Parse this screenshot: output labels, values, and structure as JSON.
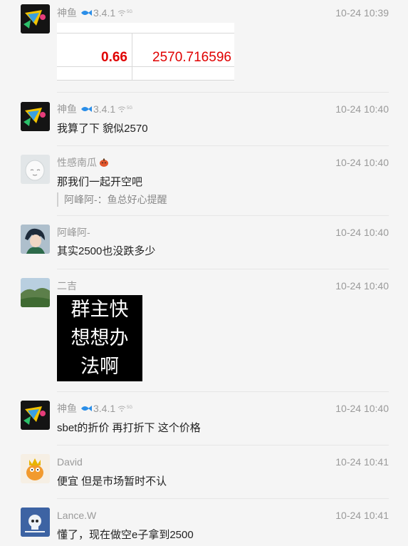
{
  "messages": [
    {
      "sender": "神鱼",
      "version": "3.4.1",
      "time": "10-24 10:39"
    },
    {
      "sender": "神鱼",
      "version": "3.4.1",
      "time": "10-24 10:40",
      "text": "我算了下 貌似2570"
    },
    {
      "sender": "性感南瓜",
      "time": "10-24 10:40",
      "text": "那我们一起开空吧",
      "quote": "阿峰阿-：鱼总好心提醒"
    },
    {
      "sender": "阿峰阿-",
      "time": "10-24 10:40",
      "text": "其实2500也没跌多少"
    },
    {
      "sender": "二吉",
      "time": "10-24 10:40"
    },
    {
      "sender": "神鱼",
      "version": "3.4.1",
      "time": "10-24 10:40",
      "text": "sbet的折价 再打折下 这个价格"
    },
    {
      "sender": "David",
      "time": "10-24 10:41",
      "text": "便宜 但是市场暂时不认"
    },
    {
      "sender": "Lance.W",
      "time": "10-24 10:41",
      "text": "懂了，现在做空e子拿到2500"
    }
  ],
  "table_image": {
    "value1": "0.66",
    "value2": "2570.716596"
  },
  "black_image": {
    "line1": "群主快",
    "line2": "想想办",
    "line3": "法啊"
  },
  "colors": {
    "accent_red": "#e00000",
    "meta_gray": "#9a9a9a"
  }
}
